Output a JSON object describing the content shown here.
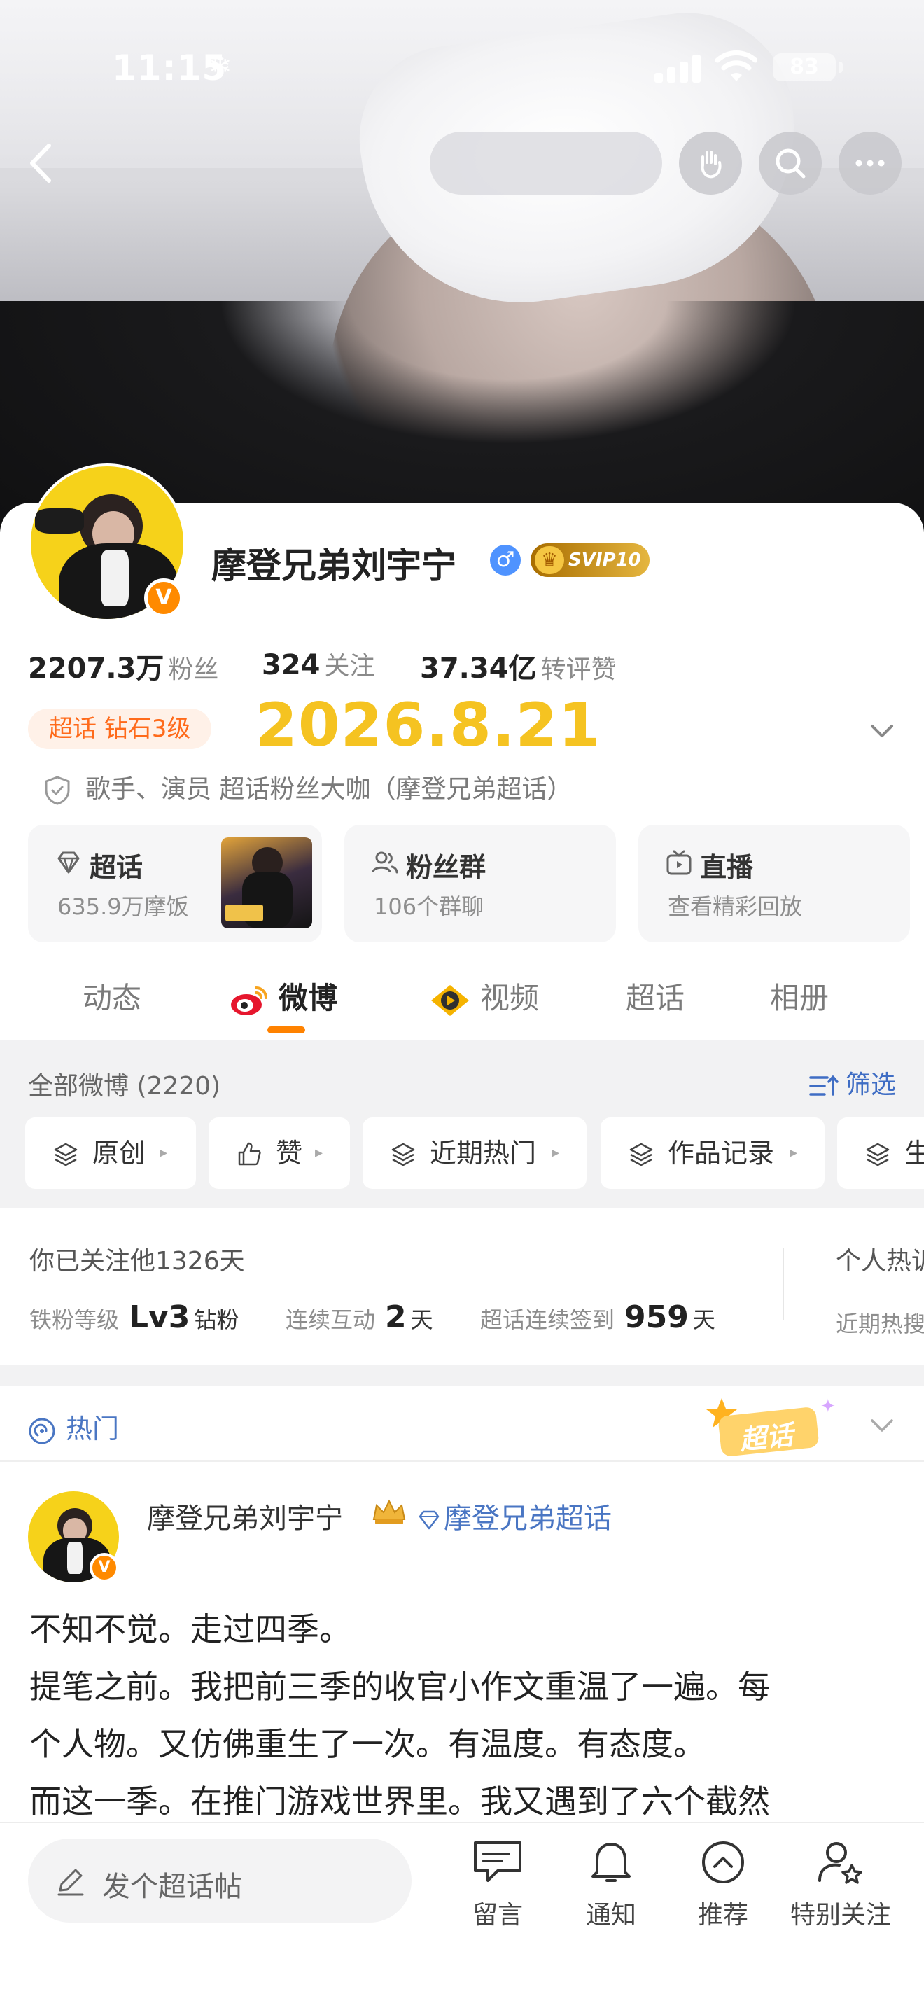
{
  "status_bar": {
    "time": "11:15",
    "battery": "83"
  },
  "profile": {
    "name": "摩登兄弟刘宇宁",
    "vip_label": "SVIP10",
    "stats": [
      {
        "value": "2207.3万",
        "label": "粉丝"
      },
      {
        "value": "324",
        "label": "关注"
      },
      {
        "value": "37.34亿",
        "label": "转评赞"
      }
    ],
    "chaohua_level": "超话 钻石3级",
    "date_text": "2026.8.21",
    "verification": "歌手、演员 超话粉丝大咖（摩登兄弟超话）"
  },
  "quick_cards": [
    {
      "title": "超话",
      "subtitle": "635.9万摩饭"
    },
    {
      "title": "粉丝群",
      "subtitle": "106个群聊"
    },
    {
      "title": "直播",
      "subtitle": "查看精彩回放"
    }
  ],
  "tabs": [
    "动态",
    "微博",
    "视频",
    "超话",
    "相册"
  ],
  "feed_filter": {
    "count_label": "全部微博 (2220)",
    "filter_label": "筛选",
    "chips": [
      "原创",
      "赞",
      "近期热门",
      "作品记录",
      "生"
    ]
  },
  "fan_stats": {
    "since": "你已关注他1326天",
    "items": [
      {
        "label": "铁粉等级",
        "value": "Lv3",
        "unit": "钻粉"
      },
      {
        "label": "连续互动",
        "value": "2",
        "unit": "天"
      },
      {
        "label": "超话连续签到",
        "value": "959",
        "unit": "天"
      }
    ],
    "side_title": "个人热诉",
    "side_sub": "近期热搜"
  },
  "hot_section": {
    "label": "热门",
    "sticker": "超话"
  },
  "post": {
    "author": "摩登兄弟刘宇宁",
    "topic": "摩登兄弟超话",
    "lines": [
      "不知不觉。走过四季。",
      "提笔之前。我把前三季的收官小作文重温了一遍。每",
      "个人物。又仿佛重生了一次。有温度。有态度。",
      "而这一季。在推门游戏世界里。我又遇到了六个截然"
    ]
  },
  "bottom_bar": {
    "compose_placeholder": "发个超话帖",
    "items": [
      "留言",
      "通知",
      "推荐",
      "特别关注"
    ]
  },
  "colors": {
    "accent_orange": "#ff8200",
    "date_yellow": "#f5c321",
    "link_blue": "#4a76c3",
    "tag_orange": "#ff6a1a"
  }
}
